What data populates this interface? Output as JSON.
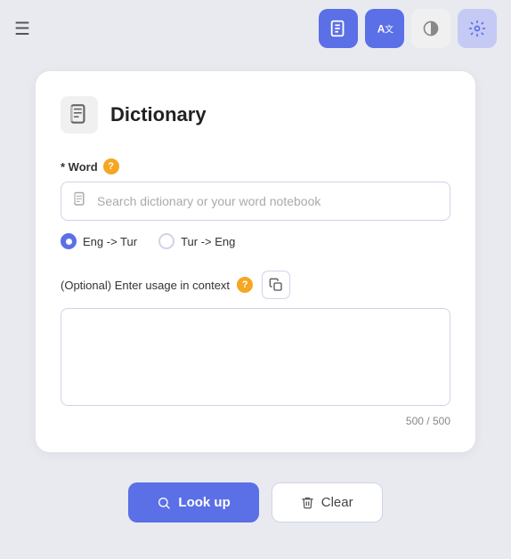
{
  "navbar": {
    "menu_icon": "☰",
    "buttons": [
      {
        "id": "book",
        "icon": "📋",
        "style": "active"
      },
      {
        "id": "translate",
        "icon": "译",
        "style": "active"
      },
      {
        "id": "theme",
        "icon": "◑",
        "style": "light"
      },
      {
        "id": "settings",
        "icon": "⚙",
        "style": "settings"
      }
    ]
  },
  "card": {
    "icon": "📖",
    "title": "Dictionary",
    "word_field": {
      "label_prefix": "* Word",
      "help_icon": "?",
      "search_placeholder": "Search dictionary or your word notebook",
      "search_value": ""
    },
    "radio_options": [
      {
        "label": "Eng -> Tur",
        "selected": true
      },
      {
        "label": "Tur -> Eng",
        "selected": false
      }
    ],
    "optional_label": "(Optional) Enter usage in context",
    "context_value": "",
    "char_current": "500",
    "char_max": "500"
  },
  "buttons": {
    "lookup_label": "Look up",
    "clear_label": "Clear"
  }
}
